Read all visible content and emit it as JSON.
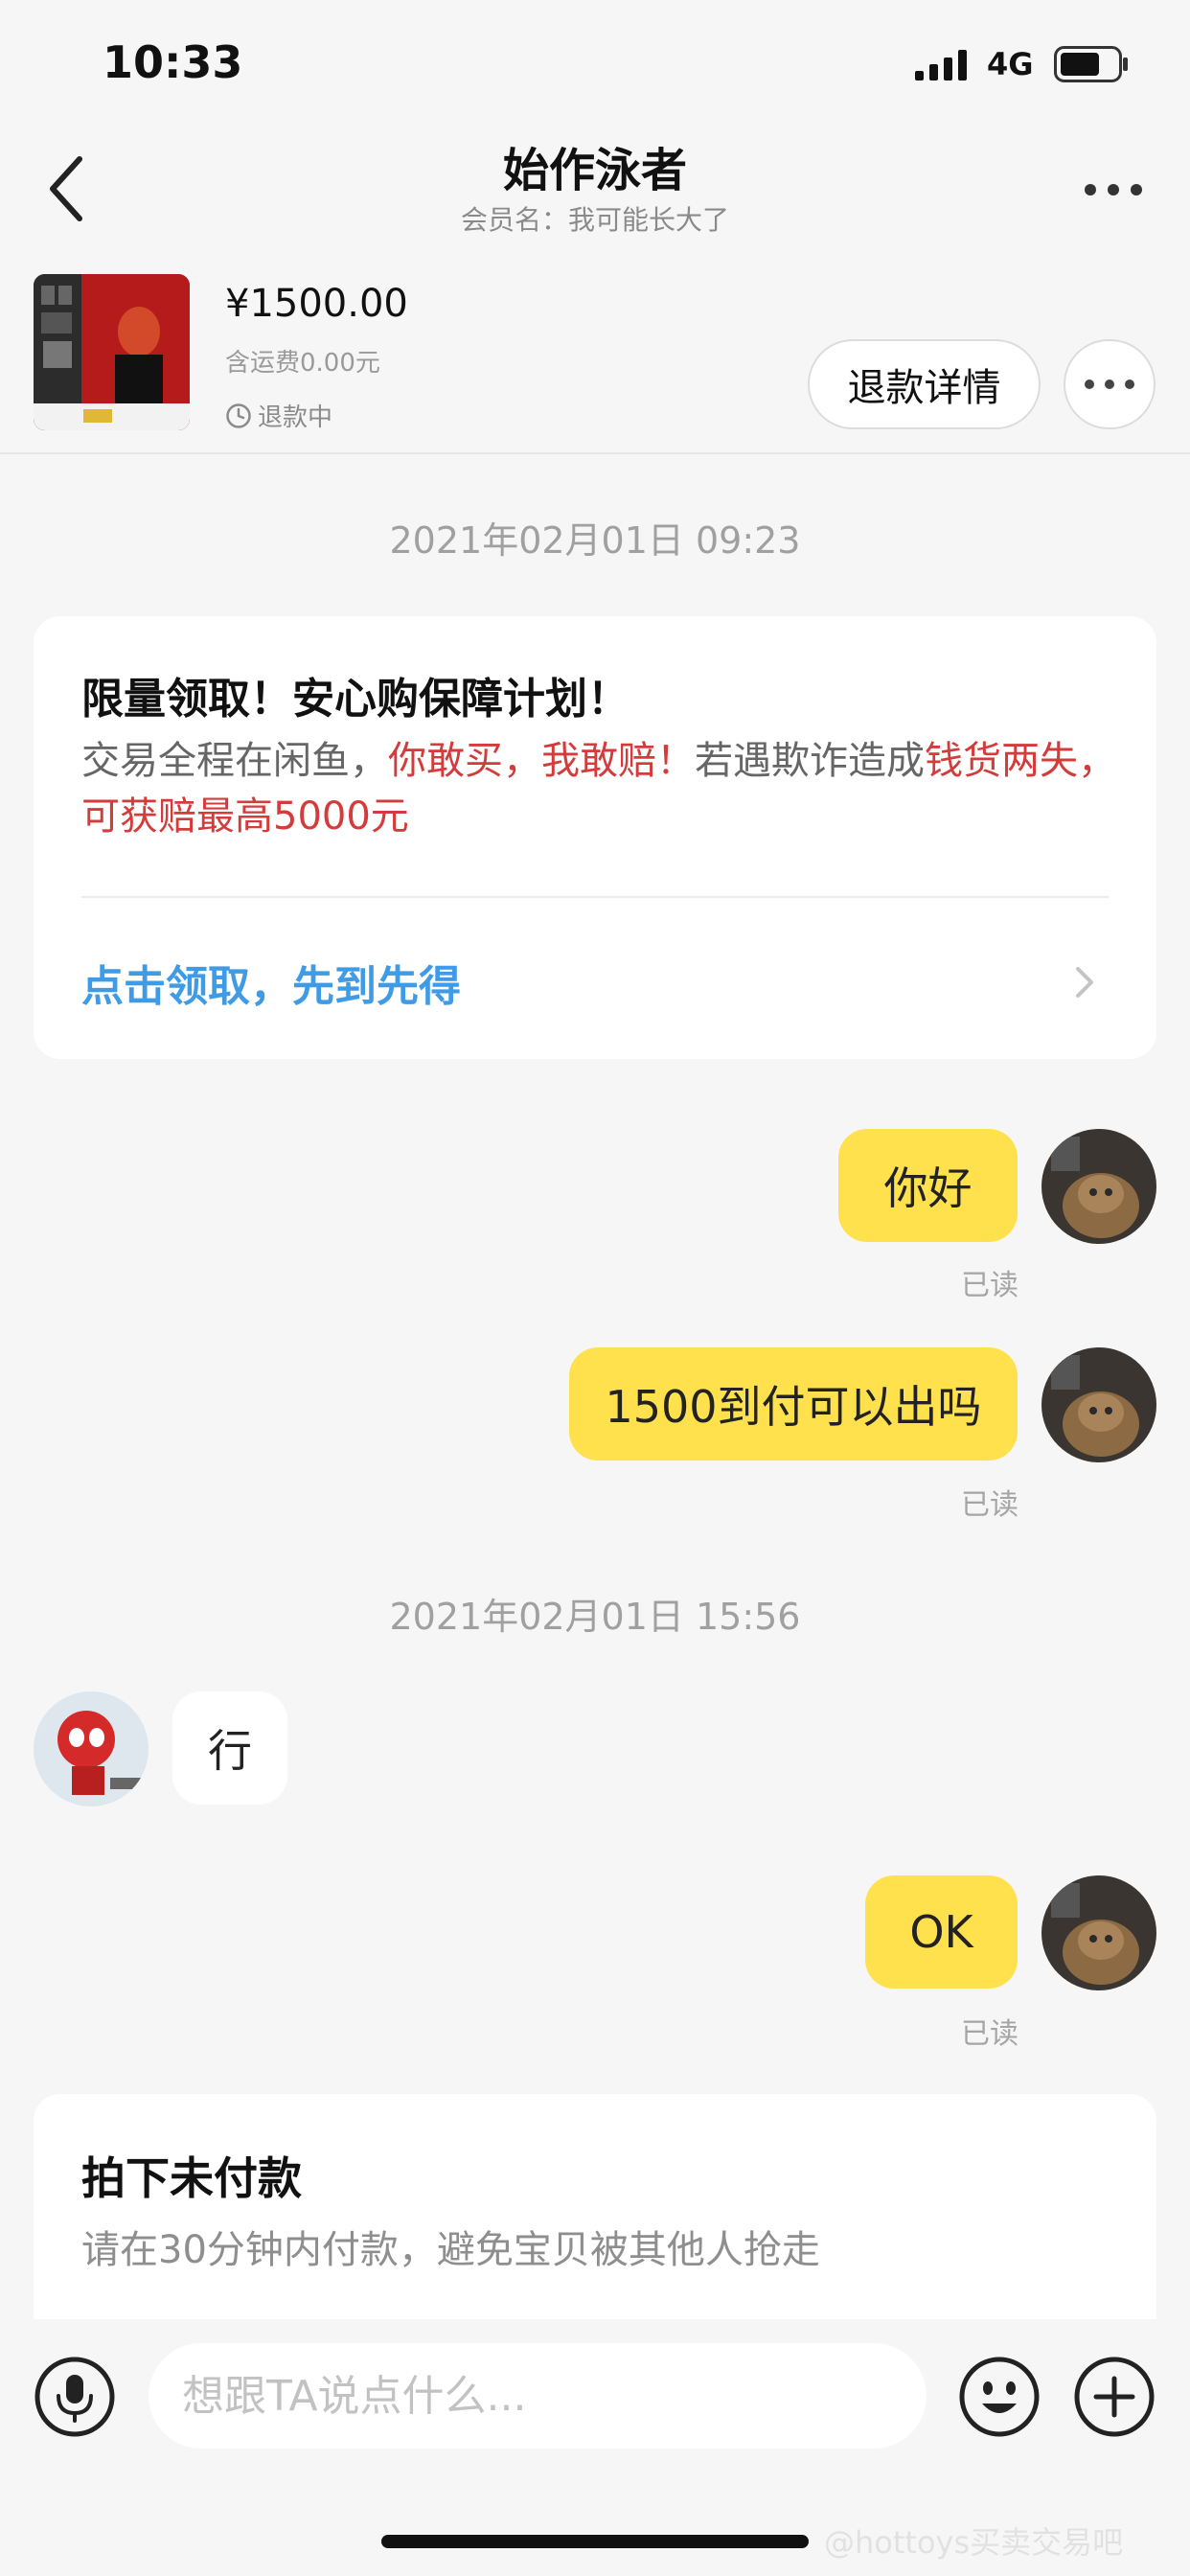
{
  "status_bar": {
    "time": "10:33",
    "network": "4G"
  },
  "header": {
    "title": "始作泳者",
    "subtitle": "会员名：我可能长大了"
  },
  "product": {
    "price": "¥1500.00",
    "shipping": "含运费0.00元",
    "status": "退款中",
    "refund_detail_label": "退款详情"
  },
  "chat": {
    "timestamp_1": "2021年02月01日 09:23",
    "promo": {
      "title": "限量领取！安心购保障计划！",
      "body_part1": "交易全程在闲鱼，",
      "body_red1": "你敢买，我敢赔！",
      "body_part2": "若遇欺诈造成",
      "body_red2": "钱货两失，可获赔最高5000元",
      "link": "点击领取，先到先得"
    },
    "messages": [
      {
        "text": "你好",
        "read": "已读"
      },
      {
        "text": "1500到付可以出吗",
        "read": "已读"
      },
      {
        "text": "行"
      },
      {
        "text": "OK",
        "read": "已读"
      }
    ],
    "timestamp_2": "2021年02月01日 15:56",
    "order": {
      "title": "拍下未付款",
      "subtitle": "请在30分钟内付款，避免宝贝被其他人抢走"
    }
  },
  "input": {
    "placeholder": "想跟TA说点什么..."
  },
  "watermark": "@hottoys买卖交易吧",
  "colors": {
    "bubble_me": "#ffe14d",
    "link_blue": "#3f9be6",
    "red": "#d43b3b"
  }
}
